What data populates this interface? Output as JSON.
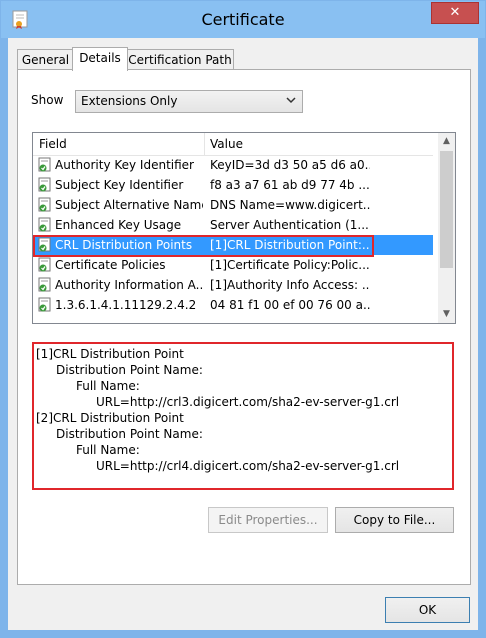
{
  "window": {
    "title": "Certificate",
    "close_glyph": "✕"
  },
  "tabs": [
    {
      "label": "General"
    },
    {
      "label": "Details"
    },
    {
      "label": "Certification Path"
    }
  ],
  "show": {
    "label": "Show",
    "selected": "Extensions Only"
  },
  "list": {
    "columns": [
      "Field",
      "Value"
    ],
    "rows": [
      {
        "field": "Authority Key Identifier",
        "value": "KeyID=3d d3 50 a5 d6 a0..."
      },
      {
        "field": "Subject Key Identifier",
        "value": "f8 a3 a7 61 ab d9 77 4b ..."
      },
      {
        "field": "Subject Alternative Name",
        "value": "DNS Name=www.digicert..."
      },
      {
        "field": "Enhanced Key Usage",
        "value": "Server Authentication (1...."
      },
      {
        "field": "CRL Distribution Points",
        "value": "[1]CRL Distribution Point:..."
      },
      {
        "field": "Certificate Policies",
        "value": "[1]Certificate Policy:Polic..."
      },
      {
        "field": "Authority Information A...",
        "value": "[1]Authority Info Access: ..."
      },
      {
        "field": "1.3.6.1.4.1.11129.2.4.2",
        "value": "04 81 f1 00 ef 00 76 00 a..."
      }
    ],
    "selected_index": 4
  },
  "details": [
    "[1]CRL Distribution Point",
    "Distribution Point Name:",
    "Full Name:",
    "URL=http://crl3.digicert.com/sha2-ev-server-g1.crl",
    "[2]CRL Distribution Point",
    "Distribution Point Name:",
    "Full Name:",
    "URL=http://crl4.digicert.com/sha2-ev-server-g1.crl"
  ],
  "buttons": {
    "edit_properties": "Edit Properties...",
    "copy_to_file": "Copy to File...",
    "ok": "OK"
  },
  "colors": {
    "selection": "#3399ff",
    "highlight_border": "#e0262b",
    "titlebar": "#89c0f2"
  }
}
